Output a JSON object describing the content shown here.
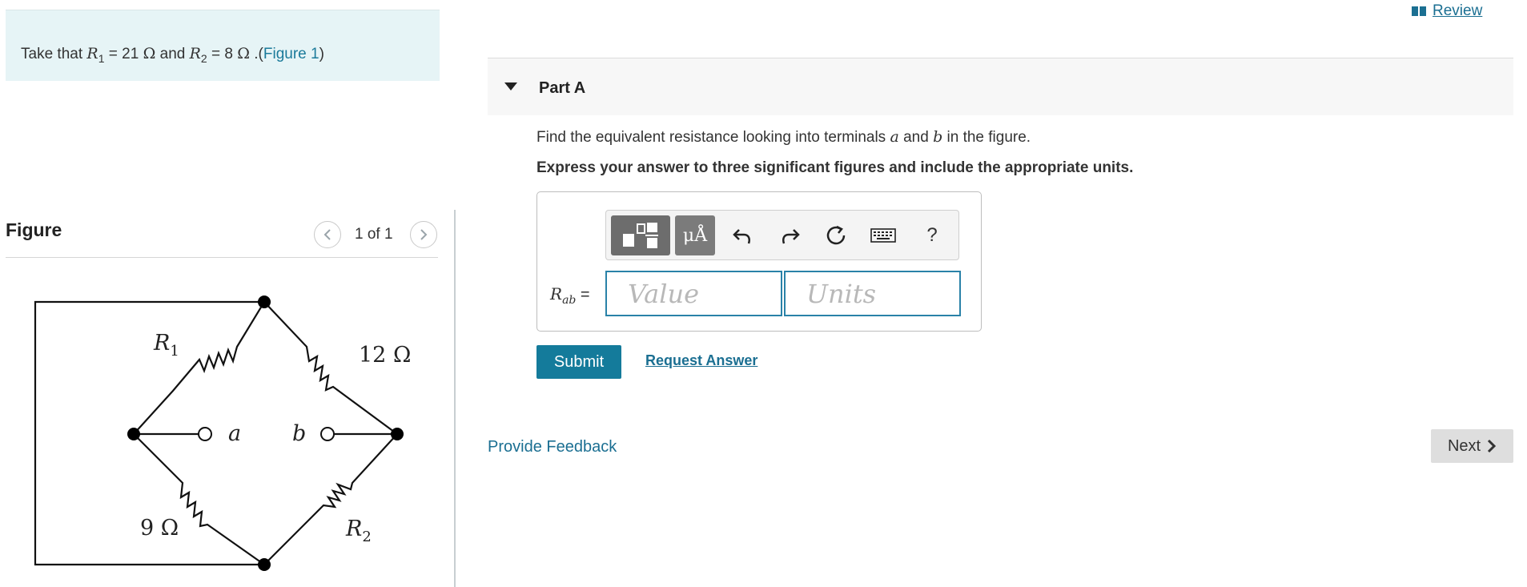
{
  "intro": {
    "prefix": "Take that ",
    "r1_symbol": "R",
    "r1_sub": "1",
    "r1_value": " = 21 ",
    "ohm": "Ω",
    "and": " and ",
    "r2_symbol": "R",
    "r2_sub": "2",
    "r2_value": " = 8 ",
    "dot_paren": " .(",
    "figure_link": "Figure 1",
    "close_paren": ")"
  },
  "figure": {
    "title": "Figure",
    "pager": "1 of 1",
    "circuit_labels": {
      "r1": "R",
      "r1_sub": "1",
      "r_top_right": "12 Ω",
      "r_bottom_left": "9 Ω",
      "r2": "R",
      "r2_sub": "2",
      "terminal_a": "a",
      "terminal_b": "b"
    }
  },
  "header": {
    "review_label": "Review"
  },
  "part": {
    "title": "Part A",
    "question_prefix": "Find the equivalent resistance looking into terminals ",
    "question_a": "a",
    "question_and": " and ",
    "question_b": "b",
    "question_suffix": " in the figure.",
    "instruction": "Express your answer to three significant figures and include the appropriate units."
  },
  "toolbar": {
    "units_button_label": "μÅ",
    "help_label": "?"
  },
  "answer": {
    "label_symbol": "R",
    "label_sub": "ab",
    "label_eq": " =",
    "value_placeholder": "Value",
    "units_placeholder": "Units"
  },
  "actions": {
    "submit_label": "Submit",
    "request_label": "Request Answer",
    "feedback_label": "Provide Feedback",
    "next_label": "Next"
  },
  "colors": {
    "accent": "#147b9b",
    "link": "#1b6f92",
    "intro_bg": "#e6f4f6"
  }
}
